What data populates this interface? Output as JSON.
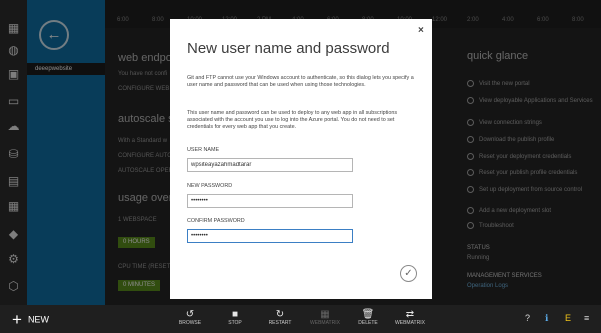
{
  "topbar": {
    "labels": [
      "6:00",
      "8:00",
      "10:00",
      "12:00",
      "2 PM",
      "4:00",
      "6:00",
      "8:00",
      "10:00",
      "12:00",
      "2:00",
      "4:00",
      "6:00",
      "8:00"
    ]
  },
  "site": {
    "name": "deeepwebsite"
  },
  "background": {
    "web_endpoint_title": "web endpoint",
    "web_endpoint_text": "You have not confi",
    "configure_web": "CONFIGURE WEB E",
    "autoscale_title": "autoscale status",
    "autoscale_text": "With a Standard w",
    "configure_auto": "CONFIGURE AUTO",
    "autoscale_oper": "AUTOSCALE OPERA",
    "usage_title": "usage overv",
    "usage_label": "1 WEBSPACE",
    "hours_badge": "0 HOURS",
    "cpu_time": "CPU TIME (RESETS",
    "minutes_badge": "0 MINUTES"
  },
  "quick_glance": {
    "title": "quick glance",
    "items": [
      "Visit the new portal",
      "View deployable Applications and Services",
      "View connection strings",
      "Download the publish profile",
      "Reset your deployment credentials",
      "Reset your publish profile credentials",
      "Set up deployment from source control",
      "Add a new deployment slot",
      "Troubleshoot"
    ],
    "status_label": "STATUS",
    "status_value": "Running",
    "mgmt_label": "MANAGEMENT SERVICES",
    "mgmt_value": "Operation Logs"
  },
  "dialog": {
    "close": "×",
    "title": "New user name and password",
    "para1": "Git and FTP cannot use your Windows account to authenticate, so this dialog lets you specify a user name and password that can be used when using those technologies.",
    "para2": "This user name and password can be used to deploy to any web app in all subscriptions associated with the account you use to log into the Azure portal. You do not need to set credentials for every web app that you create.",
    "username_label": "USER NAME",
    "username_value": "wpsiteayazahmadtarar",
    "new_password_label": "NEW PASSWORD",
    "new_password_value": "••••••••",
    "confirm_password_label": "CONFIRM PASSWORD",
    "confirm_password_value": "••••••••",
    "ok": "✓"
  },
  "commandbar": {
    "new_label": "NEW",
    "new_icon": "+",
    "items": [
      {
        "icon": "browse-icon",
        "glyph": "↺",
        "label": "BROWSE"
      },
      {
        "icon": "stop-icon",
        "glyph": "■",
        "label": "STOP"
      },
      {
        "icon": "restart-icon",
        "glyph": "↻",
        "label": "RESTART"
      },
      {
        "icon": "webmatrix-icon",
        "glyph": "▦",
        "label": "WEBMATRIX"
      },
      {
        "icon": "delete-icon",
        "glyph": "🗑",
        "label": "DELETE"
      },
      {
        "icon": "swap-icon",
        "glyph": "⇄",
        "label": "WEBMATRIX"
      }
    ],
    "tray": [
      "?",
      "ℹ",
      "E",
      "≡"
    ]
  },
  "nav_icons": [
    "grid-icon",
    "globe-icon",
    "monitor-icon",
    "gear-icon",
    "cloud-icon",
    "database-icon",
    "storage-icon",
    "table-icon",
    "box-icon",
    "settings-icon",
    "more-icon"
  ]
}
